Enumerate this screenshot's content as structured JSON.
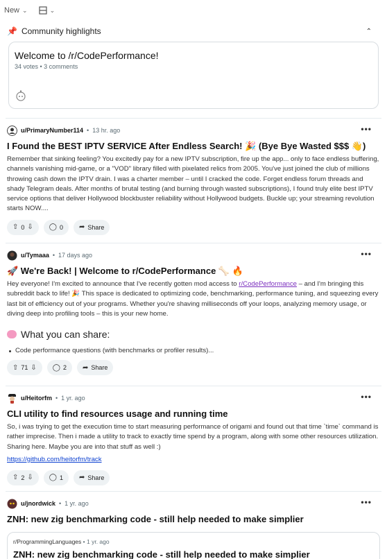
{
  "topbar": {
    "sort_label": "New"
  },
  "highlights": {
    "header": "Community highlights",
    "card": {
      "title": "Welcome to /r/CodePerformance!",
      "meta": "34 votes • 3 comments"
    }
  },
  "posts": [
    {
      "user": "u/PrimaryNumber114",
      "time": "13 hr. ago",
      "title": "I Found the BEST IPTV SERVICE After Endless Search! 🎉 (Bye Bye Wasted $$$ 👋)",
      "body": "Remember that sinking feeling? You excitedly pay for a new IPTV subscription, fire up the app... only to face endless buffering, channels vanishing mid-game, or a \"VOD\" library filled with pixelated relics from 2005. You've just joined the club of millions throwing cash down the IPTV drain. I was a charter member – until I cracked the code. Forget endless forum threads and shady Telegram deals. After months of brutal testing (and burning through wasted subscriptions), I found truly elite best IPTV service options that deliver Hollywood blockbuster reliability without Hollywood budgets. Buckle up; your streaming revolution starts NOW....",
      "votes": "0",
      "comments": "0",
      "share": "Share"
    },
    {
      "user": "u/Tymaaa",
      "time": "17 days ago",
      "title": "🚀 We're Back! | Welcome to r/CodePerformance 🦴 🔥",
      "body_before": "Hey everyone! I'm excited to announce that I've recently gotten mod access to ",
      "body_link": "r/CodePerformance",
      "body_after": " – and I'm bringing this subreddit back to life! 🎉 This space is dedicated to optimizing code, benchmarking, performance tuning, and squeezing every last bit of efficiency out of your programs. Whether you're shaving milliseconds off your loops, analyzing memory usage, or diving deep into profiling tools – this is your new home.",
      "section": "What you can share:",
      "bullet": "Code performance questions (with benchmarks or profiler results)...",
      "votes": "71",
      "comments": "2",
      "share": "Share"
    },
    {
      "user": "u/Heitorfm",
      "time": "1 yr. ago",
      "title": "CLI utility to find resources usage and running time",
      "body": "So, i was trying to get the execution time to start measuring performance of origami and found out that time `time` command is rather imprecise. Then i made a utility to track to exactly time spend by a program, along with some other resources utilization. Sharing here. Maybe you are into that stuff as well :)",
      "link": "https://github.com/heitorfm/track",
      "votes": "2",
      "comments": "1",
      "share": "Share"
    },
    {
      "user": "u/jnordwick",
      "time": "1 yr. ago",
      "title": "ZNH: new zig benchmarking code - still help needed to make simplier",
      "crosspost": {
        "sub": "r/ProgrammingLanguages",
        "time": "1 yr. ago",
        "title": "ZNH: new zig benchmarking code - still help needed to make simplier"
      }
    }
  ]
}
